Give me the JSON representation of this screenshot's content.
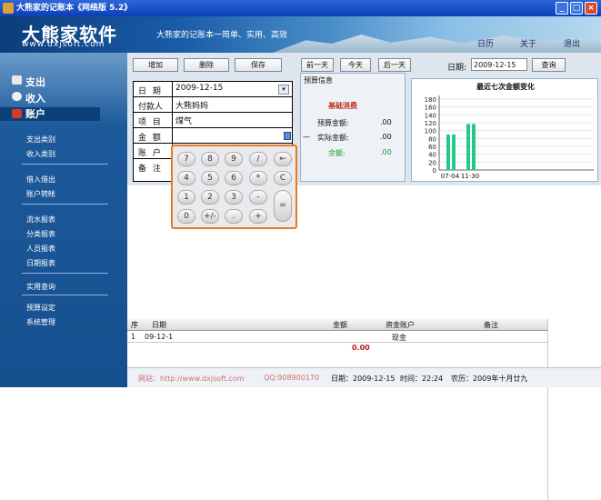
{
  "titlebar": {
    "title": "大熊家的记账本《网络版 5.2》",
    "min": "_",
    "max": "□",
    "close": "×"
  },
  "header": {
    "brand": "大熊家软件",
    "url": "www.dxjsoft.com",
    "slogan": "大熊家的记账本一简单、实用、高效",
    "nav": [
      "日历",
      "关于",
      "退出"
    ]
  },
  "sidebar": {
    "main": [
      {
        "label": "支出",
        "icon": "expense-icon",
        "color": "#e8e8e8"
      },
      {
        "label": "收入",
        "icon": "income-icon",
        "color": "#f0f0f0"
      },
      {
        "label": "账户",
        "icon": "account-icon",
        "color": "#d83a2a"
      }
    ],
    "groups": [
      [
        "支出类别",
        "收入类别"
      ],
      [
        "借入借出",
        "账户转帐"
      ],
      [
        "流水报表",
        "分类报表",
        "人员报表",
        "日期报表"
      ],
      [
        "实用查询"
      ],
      [
        "预算设定",
        "系统管理"
      ]
    ]
  },
  "toolbar": {
    "add": "增加",
    "delete": "删除",
    "save": "保存",
    "prev": "前一天",
    "today": "今天",
    "next": "后一天",
    "date_label": "日期:",
    "date_value": "2009-12-15",
    "query": "查询"
  },
  "form": {
    "rows": [
      {
        "k": "日 期",
        "v": "2009-12-15"
      },
      {
        "k": "付款人",
        "v": "大熊妈妈"
      },
      {
        "k": "项 目",
        "v": "煤气"
      },
      {
        "k": "金 额",
        "v": ""
      },
      {
        "k": "账 户",
        "v": ""
      },
      {
        "k": "备 注",
        "v": ""
      }
    ]
  },
  "budget": {
    "title": "预算信息",
    "subtitle": "基础消费",
    "budget_label": "预算金额:",
    "budget_value": ".00",
    "actual_label": "实际金额:",
    "actual_value": ".00",
    "remain_label": "余额:",
    "remain_value": ".00"
  },
  "chart_data": {
    "type": "bar",
    "title": "最近七次金额变化",
    "categories": [
      "07-04",
      "11-30"
    ],
    "values": [
      90,
      117
    ],
    "yticks": [
      0,
      20,
      40,
      60,
      80,
      100,
      120,
      140,
      160,
      180
    ],
    "ylim": [
      0,
      180
    ],
    "color": "#22cc88"
  },
  "calculator": {
    "keys": [
      [
        "7",
        "8",
        "9",
        "/",
        "←"
      ],
      [
        "4",
        "5",
        "6",
        "*",
        "C"
      ],
      [
        "1",
        "2",
        "3",
        "-",
        "="
      ],
      [
        "0",
        "+/-",
        ".",
        "+"
      ]
    ]
  },
  "table": {
    "headers": {
      "no": "序",
      "date": "日期",
      "amount": "金额",
      "account": "资金账户",
      "note": "备注"
    },
    "row": {
      "no": "1",
      "date": "09-12-1",
      "account": "现金"
    },
    "total": "0.00"
  },
  "status": {
    "site": "网站：http://www.dxjsoft.com",
    "qq": "QQ:908900170",
    "date": "日期：2009-12-15",
    "time": "时间：22:24",
    "lunar": "农历：2009年十月廿九"
  }
}
